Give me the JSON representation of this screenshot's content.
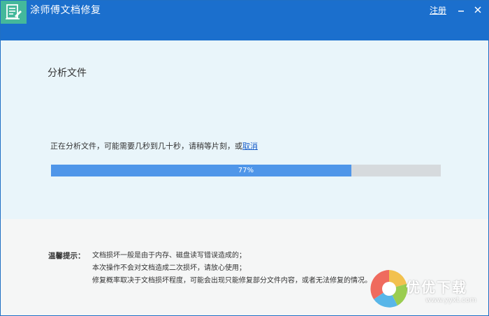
{
  "window": {
    "title": "涂师傅文档修复",
    "register_label": "注册",
    "icons": {
      "logo": "document-logo-icon",
      "minimize": "minimize-icon",
      "close": "close-icon"
    }
  },
  "main": {
    "section_title": "分析文件",
    "status_text": "正在分析文件，可能需要几秒到几十秒，请稍等片刻，或",
    "cancel_label": "取消",
    "progress": {
      "value": 77,
      "label": "77%"
    }
  },
  "footer": {
    "tip_label": "温馨提示：",
    "tips": [
      "文档损坏一般是由于内存、磁盘读写错误造成的；",
      "本次操作不会对文档造成二次损坏，请放心使用；",
      "修复概率取决于文档损坏程度，可能会出现只能修复部分文件内容，或者无法修复的情况。"
    ]
  },
  "watermark": {
    "text": "优优下载",
    "url": "www.yyxt.com"
  },
  "colors": {
    "titlebar": "#1b6fcd",
    "logo_bg": "#44b89b",
    "content_bg": "#e9f5fa",
    "progress_fill": "#4f96e9",
    "progress_track": "#d6dadd",
    "link": "#1a5fc9"
  }
}
